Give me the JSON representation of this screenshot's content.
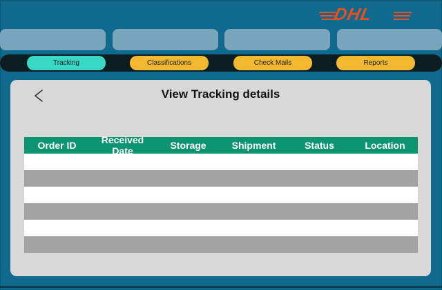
{
  "brand": {
    "logo_text": "DHL",
    "logo_color": "#e8501f"
  },
  "nav": {
    "items": [
      {
        "label": "Tracking",
        "active": true
      },
      {
        "label": "Classifications",
        "active": false
      },
      {
        "label": "Check Mails",
        "active": false
      },
      {
        "label": "Reports",
        "active": false
      }
    ]
  },
  "panel": {
    "title": "View Tracking details",
    "back_icon": "chevron-left-icon"
  },
  "table": {
    "columns": [
      "Order ID",
      "Received Date",
      "Storage",
      "Shipment",
      "Status",
      "Location"
    ],
    "rows": [
      [
        "",
        "",
        "",
        "",
        "",
        ""
      ],
      [
        "",
        "",
        "",
        "",
        "",
        ""
      ],
      [
        "",
        "",
        "",
        "",
        "",
        ""
      ],
      [
        "",
        "",
        "",
        "",
        "",
        ""
      ],
      [
        "",
        "",
        "",
        "",
        "",
        ""
      ],
      [
        "",
        "",
        "",
        "",
        "",
        ""
      ]
    ]
  },
  "colors": {
    "background": "#0f6a8e",
    "nav_bar": "#0c1d21",
    "button": "#f1b830",
    "button_active": "#38d8c4",
    "table_header": "#0d9470",
    "row_alt": "#a3a3a3"
  }
}
